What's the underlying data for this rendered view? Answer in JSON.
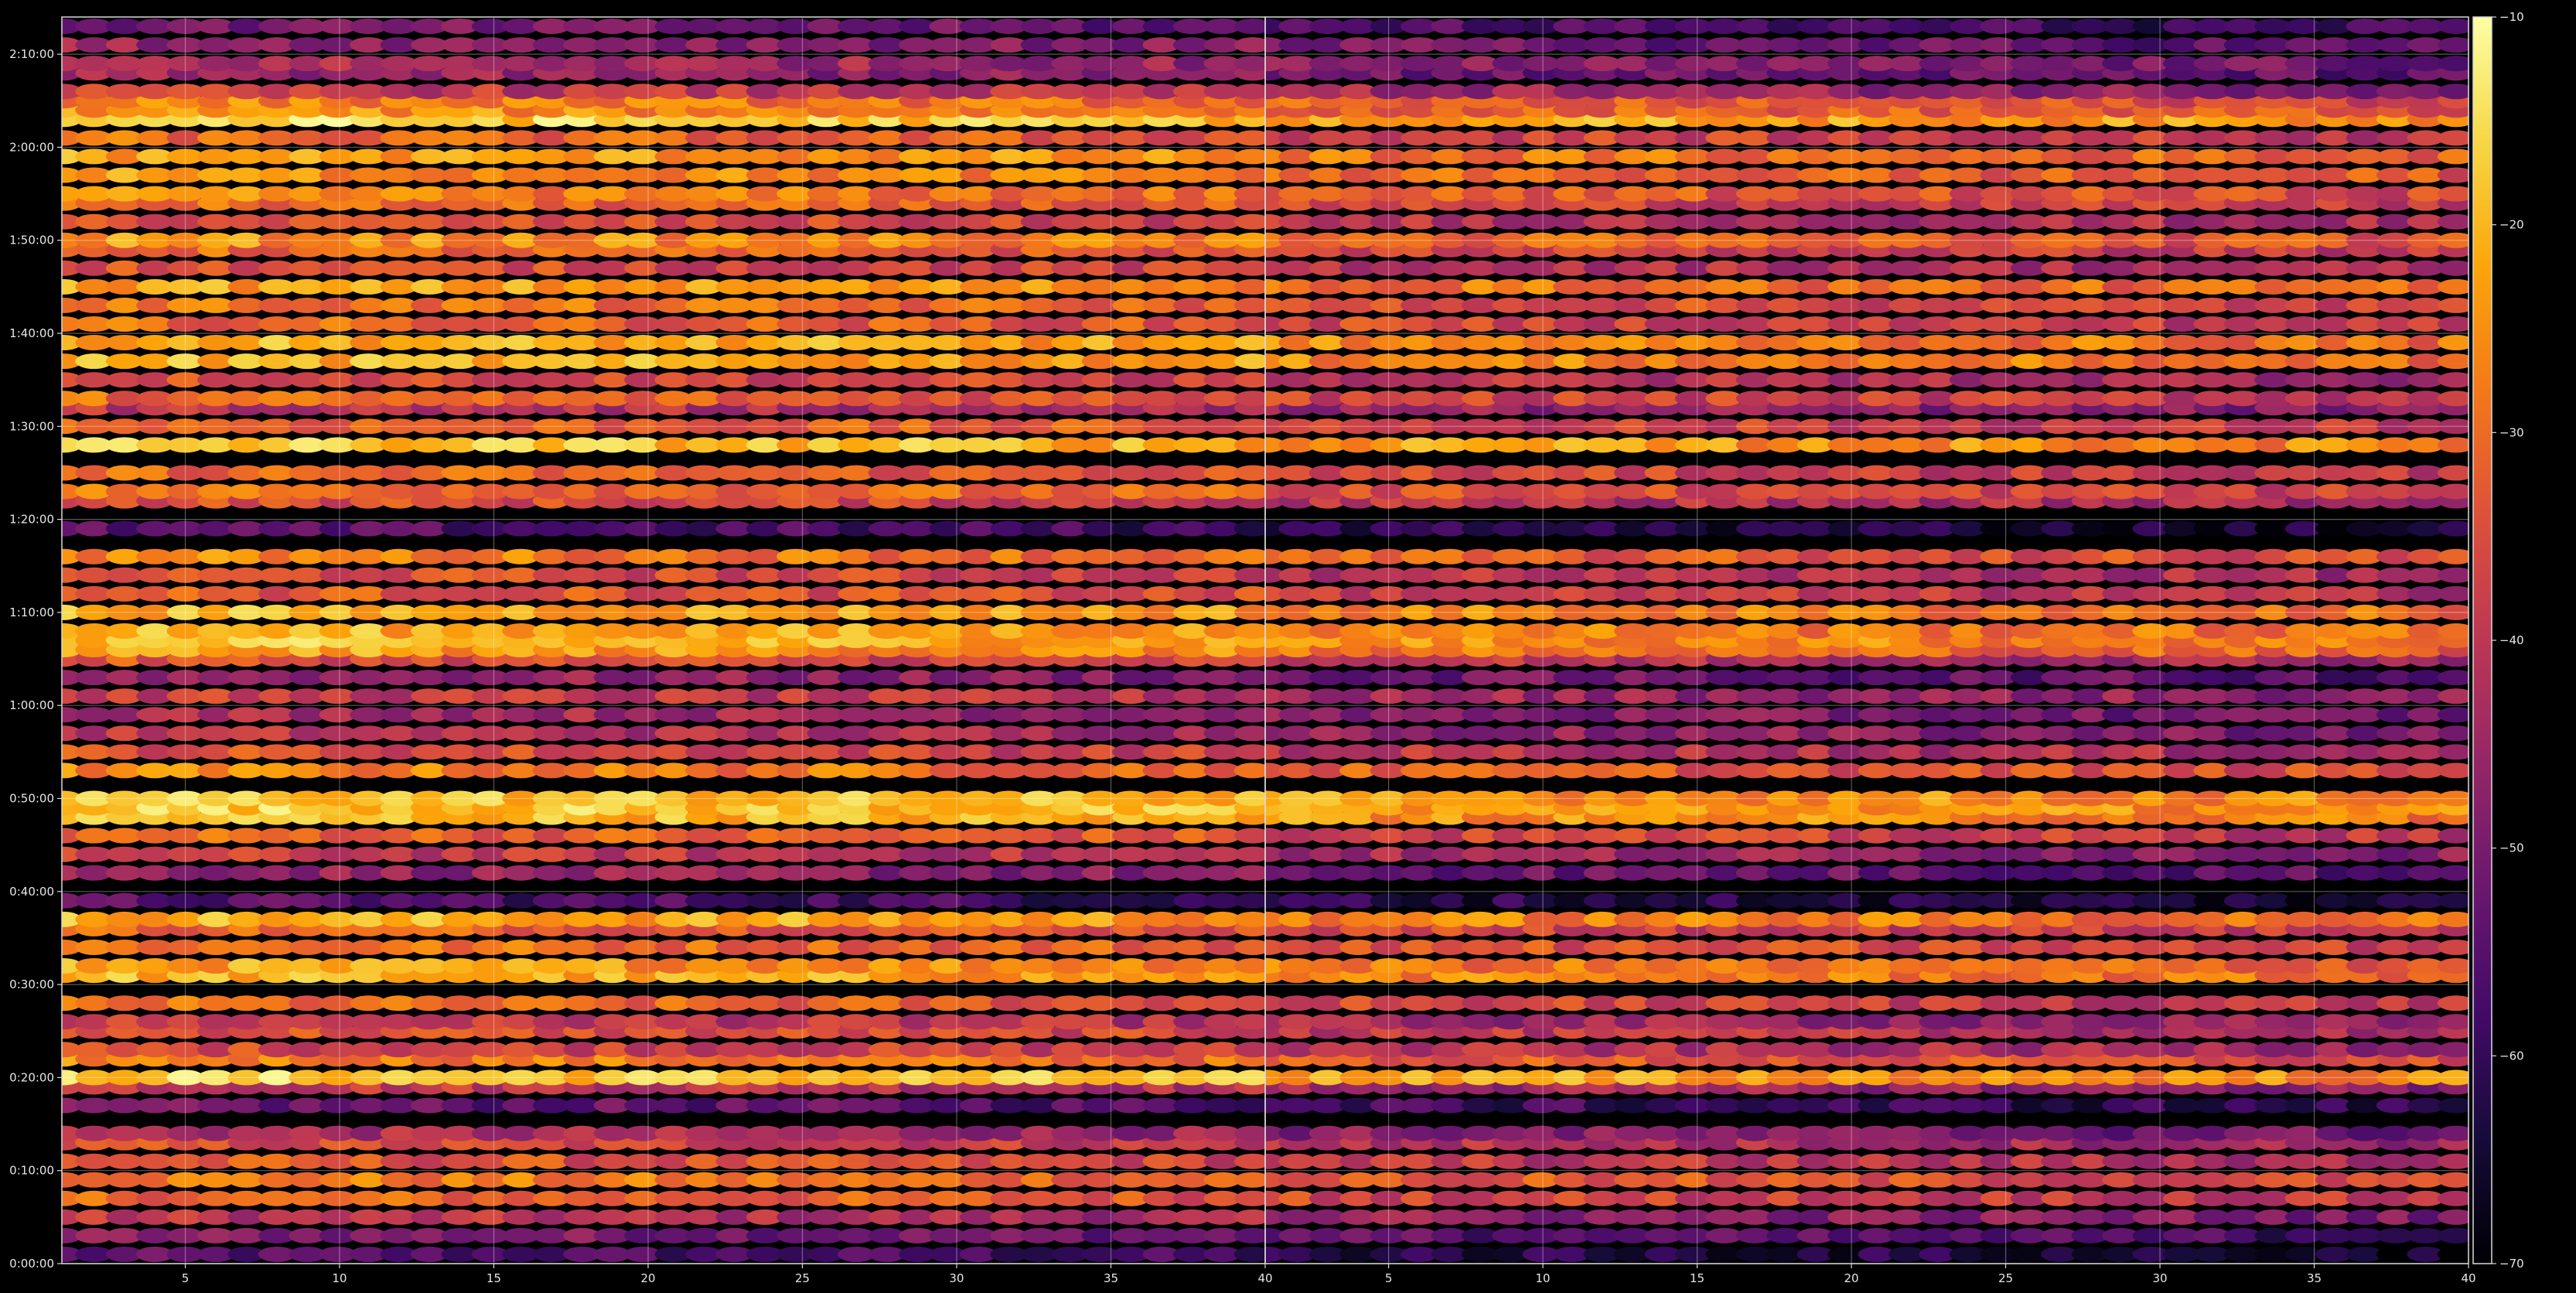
{
  "chart_data": {
    "type": "heatmap",
    "title": "",
    "xlabel": "",
    "ylabel": "",
    "colormap": "inferno",
    "background": "#000000",
    "grid": true,
    "grid_color": "#ffffff",
    "legend": "colorbar-right",
    "panels": [
      {
        "name": "",
        "xlim": [
          1,
          40
        ],
        "x_ticks": [
          "5",
          "10",
          "15",
          "20",
          "25",
          "30",
          "35",
          "40"
        ]
      },
      {
        "name": "",
        "xlim": [
          1,
          40
        ],
        "x_ticks": [
          "5",
          "10",
          "15",
          "20",
          "25",
          "30",
          "35",
          "40"
        ]
      }
    ],
    "x_columns": [
      1,
      40
    ],
    "ylim_seconds": [
      0,
      8040
    ],
    "y_ticks": [
      "0:00:00",
      "0:10:00",
      "0:20:00",
      "0:30:00",
      "0:40:00",
      "0:50:00",
      "1:00:00",
      "1:10:00",
      "1:20:00",
      "1:30:00",
      "1:40:00",
      "1:50:00",
      "2:00:00",
      "2:10:00"
    ],
    "colorbar": {
      "range": [
        -70,
        -10
      ],
      "ticks": [
        "-70",
        "-60",
        "-50",
        "-40",
        "-30",
        "-20",
        "-10"
      ]
    },
    "row_levels": [
      {
        "y": "0:01:00",
        "v": -55
      },
      {
        "y": "0:03:00",
        "v": -48
      },
      {
        "y": "0:05:00",
        "v": -40
      },
      {
        "y": "0:07:00",
        "v": -30
      },
      {
        "y": "0:09:00",
        "v": -27
      },
      {
        "y": "0:11:00",
        "v": -33
      },
      {
        "y": "0:13:00",
        "v": -35
      },
      {
        "y": "0:14:00",
        "v": -42
      },
      {
        "y": "0:17:00",
        "v": -52
      },
      {
        "y": "0:19:00",
        "v": -38
      },
      {
        "y": "0:20:00",
        "v": -16
      },
      {
        "y": "0:22:00",
        "v": -26
      },
      {
        "y": "0:23:00",
        "v": -35
      },
      {
        "y": "0:25:00",
        "v": -33
      },
      {
        "y": "0:26:00",
        "v": -38
      },
      {
        "y": "0:28:00",
        "v": -30
      },
      {
        "y": "0:31:00",
        "v": -20
      },
      {
        "y": "0:32:00",
        "v": -22
      },
      {
        "y": "0:34:00",
        "v": -28
      },
      {
        "y": "0:36:00",
        "v": -30
      },
      {
        "y": "0:37:00",
        "v": -20
      },
      {
        "y": "0:39:00",
        "v": -55
      },
      {
        "y": "0:42:00",
        "v": -45
      },
      {
        "y": "0:44:00",
        "v": -38
      },
      {
        "y": "0:46:00",
        "v": -30
      },
      {
        "y": "0:48:00",
        "v": -18
      },
      {
        "y": "0:49:00",
        "v": -16
      },
      {
        "y": "0:50:00",
        "v": -17
      },
      {
        "y": "0:53:00",
        "v": -26
      },
      {
        "y": "0:55:00",
        "v": -34
      },
      {
        "y": "0:57:00",
        "v": -40
      },
      {
        "y": "0:59:00",
        "v": -42
      },
      {
        "y": "1:01:00",
        "v": -38
      },
      {
        "y": "1:03:00",
        "v": -45
      },
      {
        "y": "1:05:00",
        "v": -34
      },
      {
        "y": "1:06:00",
        "v": -22
      },
      {
        "y": "1:07:00",
        "v": -18
      },
      {
        "y": "1:08:00",
        "v": -20
      },
      {
        "y": "1:10:00",
        "v": -20
      },
      {
        "y": "1:12:00",
        "v": -32
      },
      {
        "y": "1:14:00",
        "v": -34
      },
      {
        "y": "1:16:00",
        "v": -26
      },
      {
        "y": "1:19:00",
        "v": -55
      },
      {
        "y": "1:22:00",
        "v": -34
      },
      {
        "y": "1:23:00",
        "v": -28
      },
      {
        "y": "1:25:00",
        "v": -30
      },
      {
        "y": "1:28:00",
        "v": -17
      },
      {
        "y": "1:30:00",
        "v": -30
      },
      {
        "y": "1:32:00",
        "v": -40
      },
      {
        "y": "1:33:00",
        "v": -30
      },
      {
        "y": "1:35:00",
        "v": -34
      },
      {
        "y": "1:37:00",
        "v": -20
      },
      {
        "y": "1:39:00",
        "v": -20
      },
      {
        "y": "1:41:00",
        "v": -30
      },
      {
        "y": "1:43:00",
        "v": -28
      },
      {
        "y": "1:45:00",
        "v": -22
      },
      {
        "y": "1:47:00",
        "v": -34
      },
      {
        "y": "1:49:00",
        "v": -30
      },
      {
        "y": "1:50:00",
        "v": -24
      },
      {
        "y": "1:52:00",
        "v": -34
      },
      {
        "y": "1:54:00",
        "v": -30
      },
      {
        "y": "1:55:00",
        "v": -26
      },
      {
        "y": "1:57:00",
        "v": -24
      },
      {
        "y": "1:59:00",
        "v": -22
      },
      {
        "y": "2:01:00",
        "v": -30
      },
      {
        "y": "2:03:00",
        "v": -15
      },
      {
        "y": "2:04:00",
        "v": -24
      },
      {
        "y": "2:05:00",
        "v": -26
      },
      {
        "y": "2:06:00",
        "v": -38
      },
      {
        "y": "2:08:00",
        "v": -45
      },
      {
        "y": "2:09:00",
        "v": -42
      },
      {
        "y": "2:11:00",
        "v": -45
      },
      {
        "y": "2:13:00",
        "v": -50
      }
    ]
  }
}
